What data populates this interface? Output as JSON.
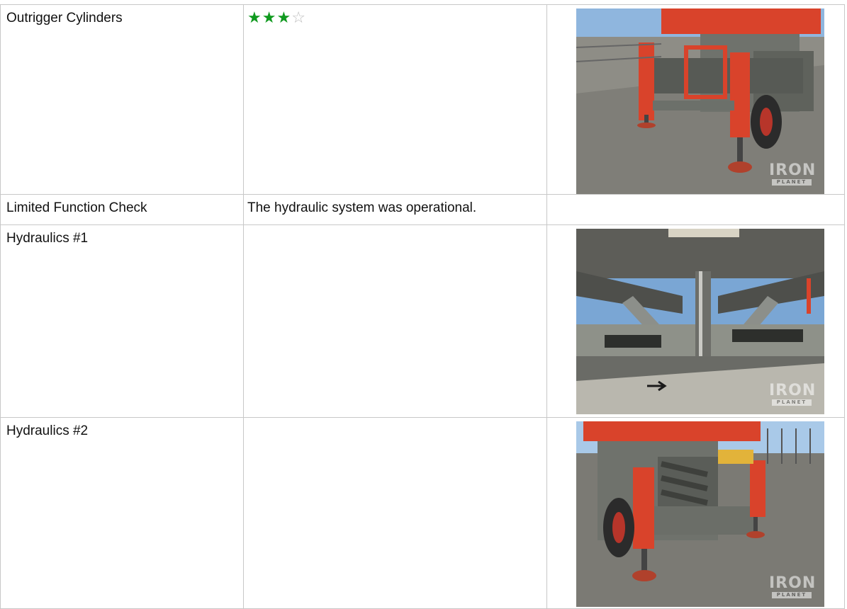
{
  "rows": [
    {
      "label": "Outrigger Cylinders",
      "rating": {
        "filled": 3,
        "total": 4
      },
      "photo": {
        "subject": "outrigger-cylinders",
        "watermark_top": "IRON",
        "watermark_bottom": "PLANET"
      }
    },
    {
      "label": "Limited Function Check",
      "value": "The hydraulic system was operational."
    },
    {
      "label": "Hydraulics #1",
      "photo": {
        "subject": "hydraulics-1",
        "watermark_top": "IRON",
        "watermark_bottom": "PLANET"
      }
    },
    {
      "label": "Hydraulics #2",
      "photo": {
        "subject": "hydraulics-2",
        "watermark_top": "IRON",
        "watermark_bottom": "PLANET"
      }
    }
  ],
  "colors": {
    "star_filled": "#109a1f",
    "star_empty": "#bdbdbd",
    "border": "#c8c8c8"
  }
}
